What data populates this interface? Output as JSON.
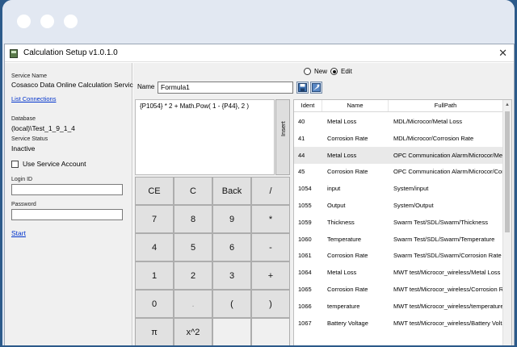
{
  "window": {
    "title": "Calculation Setup v1.0.1.0",
    "close_glyph": "✕"
  },
  "left": {
    "service_name_label": "Service Name",
    "service_name_value": "Cosasco Data Online Calculation Service",
    "list_connections": "List Connections",
    "database_label": "Database",
    "database_value": "(local)\\Test_1_9_1_4",
    "service_status_label": "Service Status",
    "service_status_value": "Inactive",
    "use_service_account": "Use Service Account",
    "login_label": "Login ID",
    "password_label": "Password",
    "start": "Start"
  },
  "mode": {
    "new": "New",
    "edit": "Edit",
    "selected": "Edit"
  },
  "name": {
    "label": "Name",
    "value": "Formula1"
  },
  "formula": "{P1054} * 2 + Math.Pow( 1 - {P44}, 2 )",
  "insert_label": "Insert",
  "keypad": [
    [
      "CE",
      "C",
      "Back",
      "/"
    ],
    [
      "7",
      "8",
      "9",
      "*"
    ],
    [
      "4",
      "5",
      "6",
      "-"
    ],
    [
      "1",
      "2",
      "3",
      "+"
    ],
    [
      "0",
      ".",
      "(",
      ")"
    ],
    [
      "π",
      "x^2",
      "",
      ""
    ]
  ],
  "grid": {
    "headers": [
      "Ident",
      "Name",
      "FullPath"
    ],
    "rows": [
      [
        "40",
        "Metal Loss",
        "MDL/Microcor/Metal Loss"
      ],
      [
        "41",
        "Corrosion Rate",
        "MDL/Microcor/Corrosion Rate"
      ],
      [
        "44",
        "Metal Loss",
        "OPC Communication Alarm/Microcor/Metal Loss"
      ],
      [
        "45",
        "Corrosion Rate",
        "OPC Communication Alarm/Microcor/Corrosion Rate"
      ],
      [
        "1054",
        "input",
        "System/input"
      ],
      [
        "1055",
        "Output",
        "System/Output"
      ],
      [
        "1059",
        "Thickness",
        "Swarm Test/SDL/Swarm/Thickness"
      ],
      [
        "1060",
        "Temperature",
        "Swarm Test/SDL/Swarm/Temperature"
      ],
      [
        "1061",
        "Corrosion Rate",
        "Swarm Test/SDL/Swarm/Corrosion Rate"
      ],
      [
        "1064",
        "Metal Loss",
        "MWT test/Microcor_wireless/Metal Loss"
      ],
      [
        "1065",
        "Corrosion Rate",
        "MWT test/Microcor_wireless/Corrosion Rate"
      ],
      [
        "1066",
        "temperature",
        "MWT test/Microcor_wireless/temperature"
      ],
      [
        "1067",
        "Battery Voltage",
        "MWT test/Microcor_wireless/Battery Voltage"
      ]
    ],
    "selected_row": 2
  },
  "colors": {
    "frame": "#2c5a8a",
    "chrome": "#e2e8f2",
    "link": "#0033cc",
    "selection": "#e9e9e9"
  }
}
